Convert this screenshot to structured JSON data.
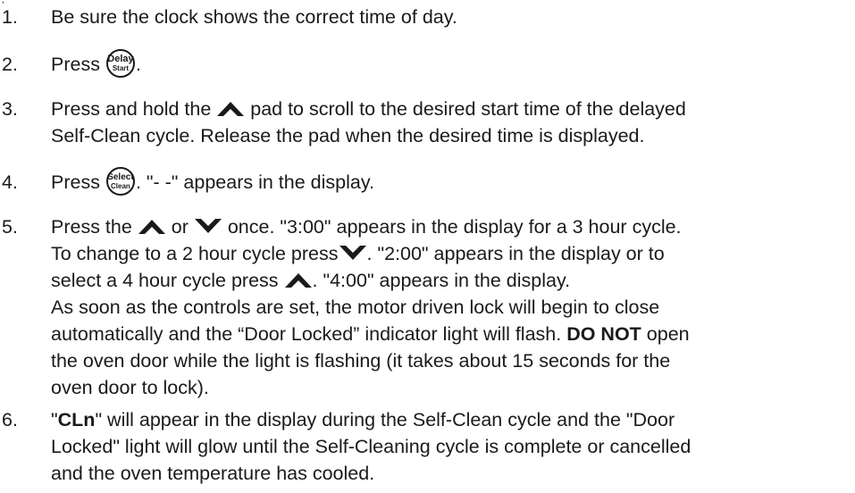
{
  "top_mark": ",",
  "icons": {
    "delay_start": {
      "top": "Delay",
      "bottom": "Start"
    },
    "select_clean": {
      "top": "Select",
      "bottom": "Clean"
    },
    "up_arrow": "up-arrow-icon",
    "down_arrow": "down-arrow-icon"
  },
  "steps": [
    {
      "num": "1.",
      "line1": "Be sure the clock shows the correct time of day."
    },
    {
      "num": "2.",
      "pre": "Press ",
      "post": "."
    },
    {
      "num": "3.",
      "pre": "Press and hold the ",
      "post": " pad to scroll to the desired start time of the delayed",
      "line2": "Self-Clean cycle. Release the pad when the desired time is displayed."
    },
    {
      "num": "4.",
      "pre": "Press ",
      "post": ". \"- -\" appears in the display."
    },
    {
      "num": "5.",
      "l1a": "Press the ",
      "l1b": " or ",
      "l1c": " once. \"3:00\" appears in the display for a 3 hour cycle.",
      "l2a": "To change to a 2 hour cycle press",
      "l2b": ". \"2:00\" appears in the display or to",
      "l3a": "select a 4 hour cycle press ",
      "l3b": ". \"4:00\" appears in the display.",
      "l4": "As soon as the controls are set, the motor driven lock will begin to close",
      "l5a": "automatically and the “Door Locked” indicator light will flash. ",
      "l5bold": "DO NOT",
      "l5b": " open",
      "l6": "the oven door while the light is flashing (it takes about 15 seconds for the",
      "l7": "oven door to lock)."
    },
    {
      "num": "6.",
      "l1a": "\"",
      "l1bold": "CLn",
      "l1b": "\" will appear in the display during the Self-Clean cycle and the \"Door",
      "l2": "Locked\" light will glow until the Self-Cleaning cycle is complete or cancelled",
      "l3": "and the oven temperature has cooled."
    }
  ]
}
